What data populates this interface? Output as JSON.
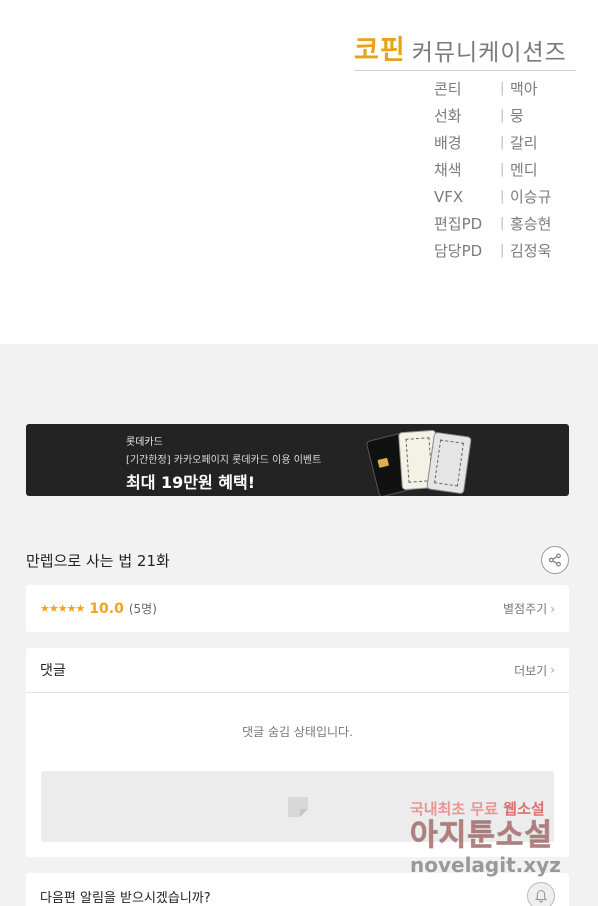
{
  "credits": {
    "studio_brand": "코핀",
    "studio_name": "커뮤니케이션즈",
    "rows": [
      {
        "role": "콘티",
        "name": "맥아"
      },
      {
        "role": "선화",
        "name": "뭉"
      },
      {
        "role": "배경",
        "name": "갈리"
      },
      {
        "role": "채색",
        "name": "멘디"
      },
      {
        "role": "VFX",
        "name": "이승규"
      },
      {
        "role": "편집PD",
        "name": "홍승현"
      },
      {
        "role": "담당PD",
        "name": "김정욱"
      }
    ],
    "separator": "|"
  },
  "banner": {
    "brand": "롯데카드",
    "subtitle": "[기간한정] 카카오페이지 롯데카드 이용 이벤트",
    "headline": "최대 19만원 혜택!"
  },
  "episode": {
    "title": "만렙으로 사는 법 21화",
    "share_icon": "share-icon"
  },
  "rating": {
    "stars": "★★★★★",
    "score": "10.0",
    "count": "(5명)",
    "rate_label": "별점주기",
    "chevron": "›"
  },
  "comments": {
    "title": "댓글",
    "more_label": "더보기",
    "chevron": "›",
    "hidden_message": "댓글 숨김 상태입니다."
  },
  "notify": {
    "question": "다음편 알림을 받으시겠습니까?",
    "bell_icon": "bell-icon"
  },
  "watermark": {
    "line1_prefix": "국내최초 무료",
    "line1_highlight": "웹소설",
    "line2": "아지툰소설",
    "line3": "novelagit.xyz"
  },
  "colors": {
    "accent": "#f0a41c",
    "studio_brand": "#e8a11b",
    "banner_bg": "#232323",
    "page_bg": "#f2f2f2"
  }
}
